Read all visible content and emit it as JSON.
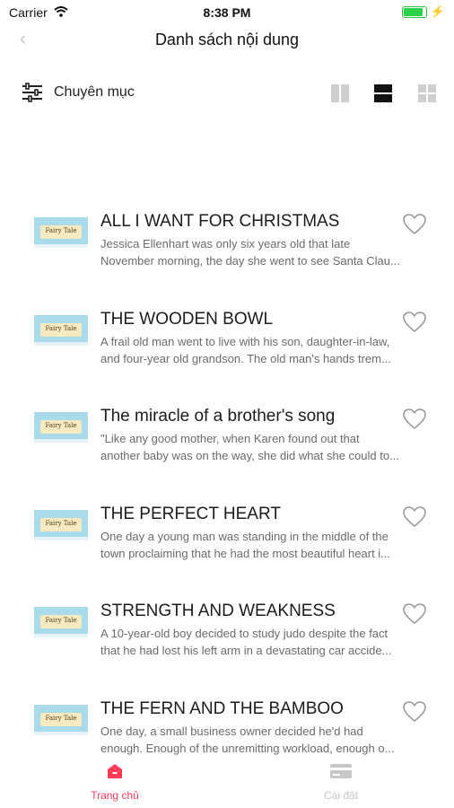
{
  "status_bar": {
    "carrier": "Carrier",
    "time": "8:38 PM",
    "battery_level": 0.9
  },
  "nav": {
    "title": "Danh sách nội dung"
  },
  "filter": {
    "label": "Chuyên mục"
  },
  "colors": {
    "accent": "#ff3b57",
    "icon_grey": "#c8c8c8",
    "thumb_sky": "#a9dbea"
  },
  "stories": [
    {
      "thumb_text": "Fairy Tale",
      "title": "ALL I WANT FOR CHRISTMAS",
      "line1": "Jessica Ellenhart was only six years old that late",
      "line2": "November morning, the day she went to see Santa Clau..."
    },
    {
      "thumb_text": "Fairy Tale",
      "title": "THE WOODEN BOWL",
      "line1": "A frail old man went to live with his son, daughter-in-law,",
      "line2": "and four-year old grandson. The old man's hands trem..."
    },
    {
      "thumb_text": "Fairy Tale",
      "title": "The miracle of a brother's song",
      "line1": "\"Like any good mother, when Karen found out that",
      "line2": "another baby was on the way, she did what she could to..."
    },
    {
      "thumb_text": "Fairy Tale",
      "title": "THE PERFECT HEART",
      "line1": "One day a young man was standing in the middle of the",
      "line2": "town proclaiming that he had the most beautiful heart i..."
    },
    {
      "thumb_text": "Fairy Tale",
      "title": "STRENGTH AND WEAKNESS",
      "line1": "A 10-year-old boy decided to study judo despite the fact",
      "line2": "that he had lost his left arm in a devastating car accide..."
    },
    {
      "thumb_text": "Fairy Tale",
      "title": "THE FERN AND THE BAMBOO",
      "line1": "One day, a small business owner decided he'd had",
      "line2": "enough. Enough of the unremitting workload, enough o..."
    }
  ],
  "tabs": {
    "home": "Trang chủ",
    "settings": "Cài đặt"
  }
}
